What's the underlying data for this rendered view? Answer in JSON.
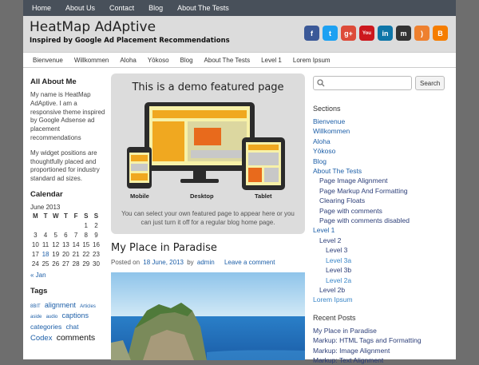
{
  "top_nav": [
    "Home",
    "About Us",
    "Contact",
    "Blog",
    "About The Tests"
  ],
  "header": {
    "title": "HeatMap AdAptive",
    "tagline": "Inspired by Google Ad Placement Recommendations",
    "social": [
      {
        "name": "facebook-icon",
        "glyph": "f",
        "color": "#3b5998"
      },
      {
        "name": "twitter-icon",
        "glyph": "t",
        "color": "#1da1f2"
      },
      {
        "name": "google-plus-icon",
        "glyph": "g+",
        "color": "#dd4b39"
      },
      {
        "name": "youtube-icon",
        "glyph": "You",
        "color": "#cc181e"
      },
      {
        "name": "linkedin-icon",
        "glyph": "in",
        "color": "#0e76a8"
      },
      {
        "name": "myspace-icon",
        "glyph": "m",
        "color": "#333333"
      },
      {
        "name": "rss-icon",
        "glyph": ")",
        "color": "#ee802f"
      },
      {
        "name": "blogger-icon",
        "glyph": "B",
        "color": "#f57d00"
      }
    ]
  },
  "sub_nav": [
    "Bienvenue",
    "Willkommen",
    "Aloha",
    "Yōkoso",
    "Blog",
    "About The Tests",
    "Level 1",
    "Lorem Ipsum"
  ],
  "left": {
    "about_title": "All About Me",
    "about_text_1": "My name is HeatMap AdAptive. I am a responsive theme inspired by Google Adsense ad placement recommendations",
    "about_text_2": "My widget positions are thoughtfully placed and proportioned for industry standard ad sizes.",
    "calendar_title": "Calendar",
    "calendar_caption": "June 2013",
    "calendar_days": [
      "M",
      "T",
      "W",
      "T",
      "F",
      "S",
      "S"
    ],
    "calendar_rows": [
      [
        "",
        "",
        "",
        "",
        "",
        "1",
        "2"
      ],
      [
        "3",
        "4",
        "5",
        "6",
        "7",
        "8",
        "9"
      ],
      [
        "10",
        "11",
        "12",
        "13",
        "14",
        "15",
        "16"
      ],
      [
        "17",
        "18",
        "19",
        "20",
        "21",
        "22",
        "23"
      ],
      [
        "24",
        "25",
        "26",
        "27",
        "28",
        "29",
        "30"
      ]
    ],
    "calendar_prev": "« Jan",
    "tags_title": "Tags",
    "tags": [
      "8BIT",
      "alignment",
      "Articles",
      "aside",
      "audio",
      "captions",
      "categories",
      "chat",
      "Codex",
      "comments"
    ]
  },
  "featured": {
    "title": "This is a demo featured page",
    "labels": [
      "Mobile",
      "Desktop",
      "Tablet"
    ],
    "caption": "You can select your own featured page to appear here or you can just turn it off for a regular blog home page."
  },
  "post": {
    "title": "My Place in Paradise",
    "posted_on": "Posted on",
    "date": "18 June, 2013",
    "by": "by",
    "author": "admin",
    "comment_link": "Leave a comment"
  },
  "right": {
    "search_button": "Search",
    "sections_title": "Sections",
    "sections": [
      {
        "label": "Bienvenue",
        "level": 0
      },
      {
        "label": "Willkommen",
        "level": 0
      },
      {
        "label": "Aloha",
        "level": 0
      },
      {
        "label": "Yōkoso",
        "level": 0
      },
      {
        "label": "Blog",
        "level": 0
      },
      {
        "label": "About The Tests",
        "level": 0
      },
      {
        "label": "Page Image Alignment",
        "level": 1
      },
      {
        "label": "Page Markup And Formatting",
        "level": 1
      },
      {
        "label": "Clearing Floats",
        "level": 1
      },
      {
        "label": "Page with comments",
        "level": 1
      },
      {
        "label": "Page with comments disabled",
        "level": 1
      },
      {
        "label": "Level 1",
        "level": 0
      },
      {
        "label": "Level 2",
        "level": 1
      },
      {
        "label": "Level 3",
        "level": 2
      },
      {
        "label": "Level 3a",
        "level": 3
      },
      {
        "label": "Level 3b",
        "level": 2
      },
      {
        "label": "Level 2a",
        "level": 3
      },
      {
        "label": "Level 2b",
        "level": 1
      },
      {
        "label": "Lorem Ipsum",
        "level": 4
      }
    ],
    "recent_title": "Recent Posts",
    "recent_posts": [
      "My Place in Paradise",
      "Markup: HTML Tags and Formatting",
      "Markup: Image Alignment",
      "Markup: Text Alignment"
    ]
  }
}
